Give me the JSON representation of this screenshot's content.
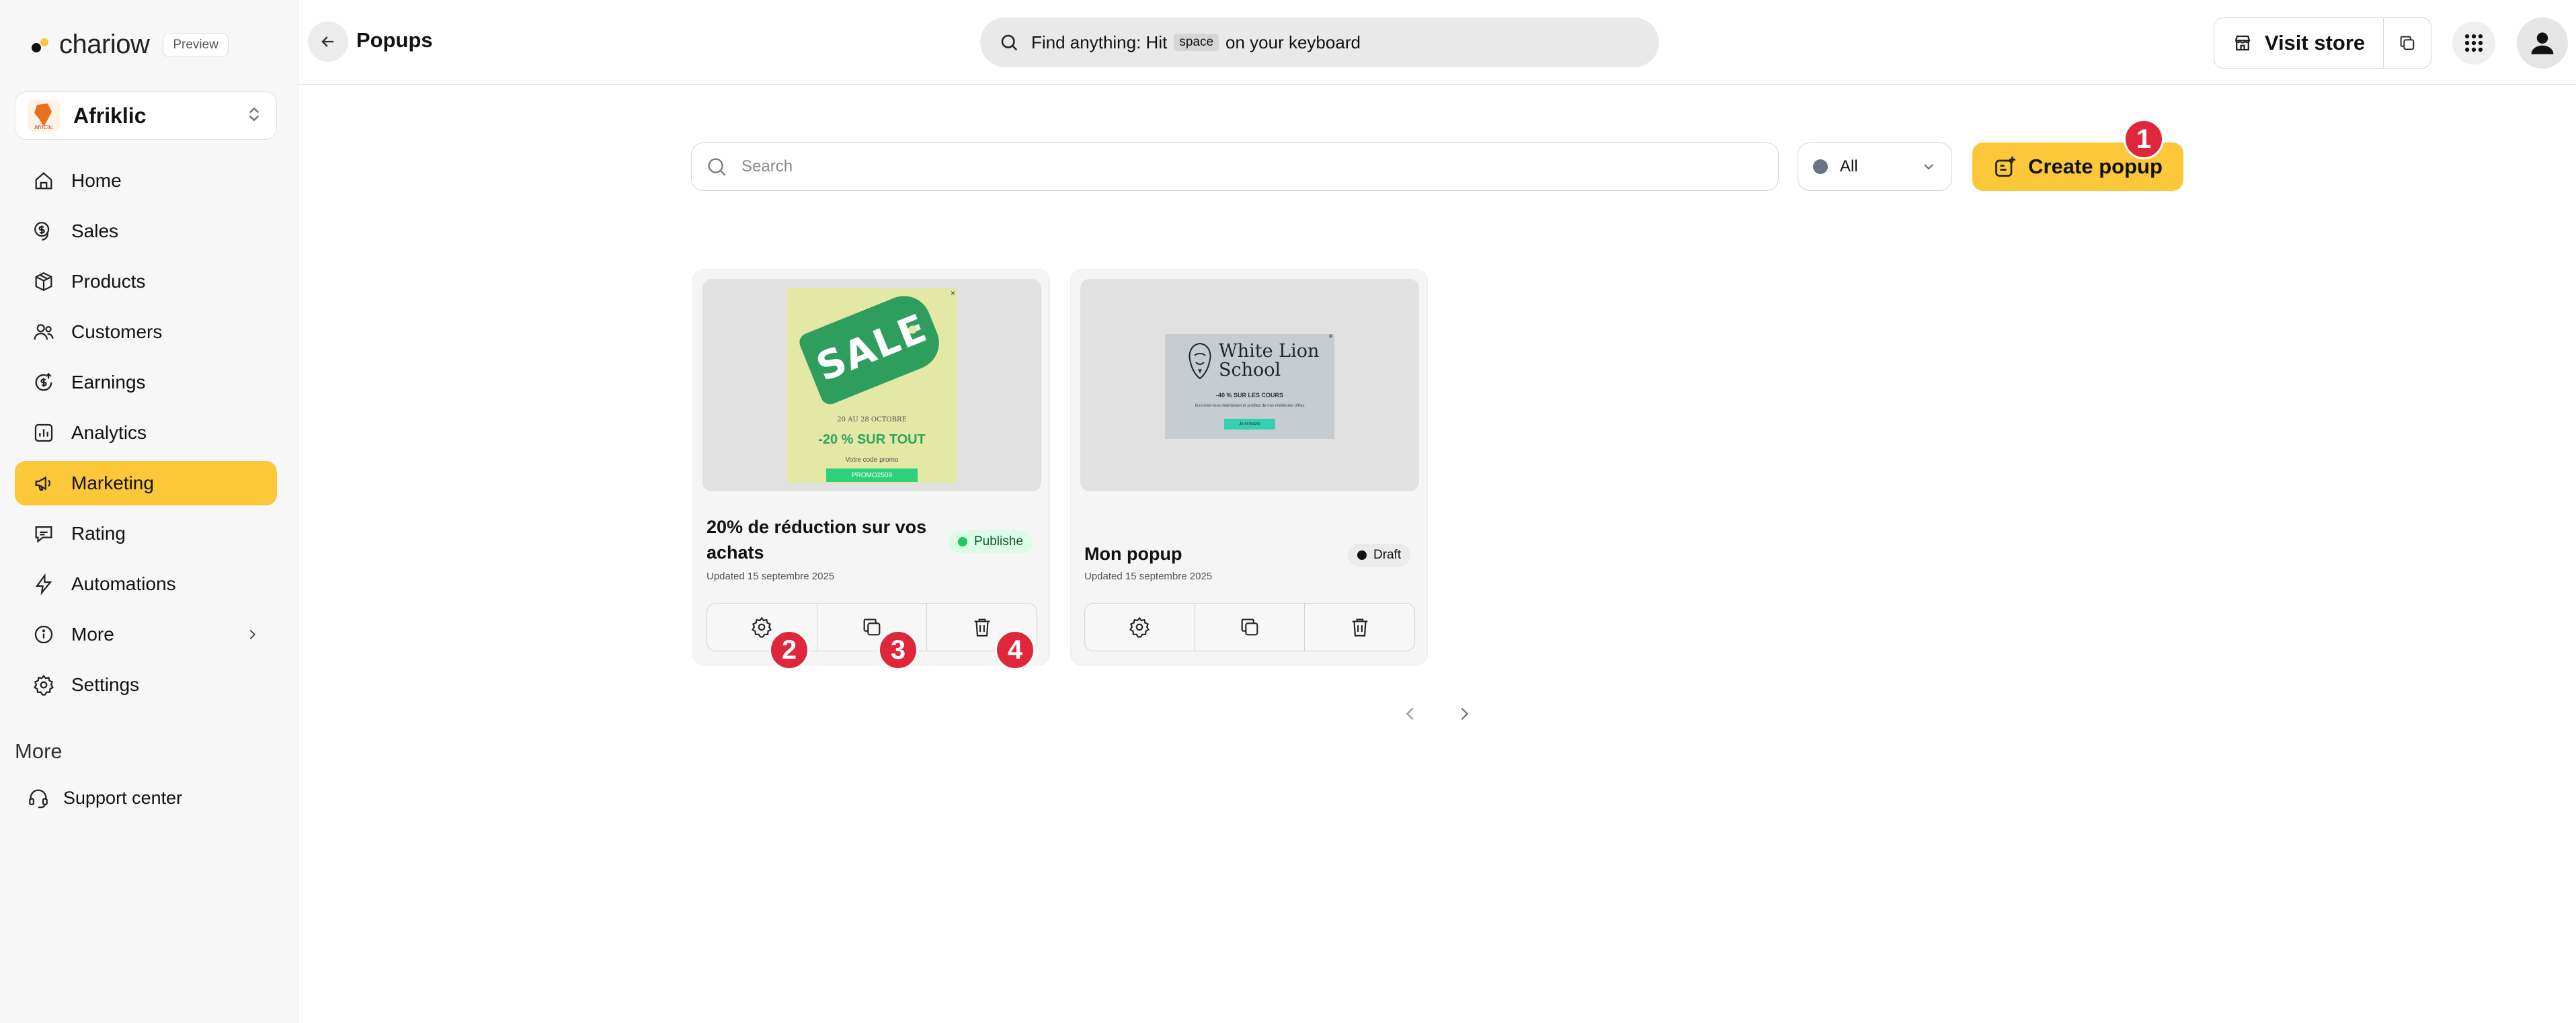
{
  "app": {
    "logo_text": "chariow",
    "preview_label": "Preview",
    "store_name": "Afriklic",
    "store_logo_text": "AfriClic"
  },
  "sidebar": {
    "items": [
      {
        "label": "Home",
        "icon": "home-icon"
      },
      {
        "label": "Sales",
        "icon": "dollar-coin-icon"
      },
      {
        "label": "Products",
        "icon": "box-icon"
      },
      {
        "label": "Customers",
        "icon": "users-icon"
      },
      {
        "label": "Earnings",
        "icon": "earnings-icon"
      },
      {
        "label": "Analytics",
        "icon": "bar-chart-icon"
      },
      {
        "label": "Marketing",
        "icon": "megaphone-icon",
        "active": true
      },
      {
        "label": "Rating",
        "icon": "chat-star-icon"
      },
      {
        "label": "Automations",
        "icon": "lightning-icon"
      },
      {
        "label": "More",
        "icon": "info-icon"
      },
      {
        "label": "Settings",
        "icon": "gear-icon"
      }
    ],
    "more_heading": "More",
    "support_label": "Support center"
  },
  "header": {
    "title": "Popups",
    "search_prefix": "Find anything: Hit",
    "search_key": "space",
    "search_suffix": "on your keyboard",
    "visit_store_label": "Visit store"
  },
  "toolbar": {
    "search_placeholder": "Search",
    "filter_value": "All",
    "create_label": "Create popup"
  },
  "markers": [
    "1",
    "2",
    "3",
    "4"
  ],
  "popups": [
    {
      "title": "20% de réduction sur vos achats",
      "status": "Publishe",
      "updated": "Updated 15 septembre 2025",
      "preview": {
        "tag_text": "SALE",
        "date_text": "20 AU 28 OCTOBRE",
        "discount_text": "-20 % SUR TOUT",
        "code_label": "Votre code promo",
        "code": "PROMO2509",
        "close": "×"
      }
    },
    {
      "title": "Mon popup",
      "status": "Draft",
      "updated": "Updated 15 septembre 2025",
      "preview": {
        "brand_line1": "White Lion",
        "brand_line2": "School",
        "discount_text": "-40 % SUR LES COURS",
        "description": "Inscrivez-vous maintenant et profitez de nos meilleures offres",
        "button_text": "Je m'inscris",
        "close": "×"
      }
    }
  ],
  "colors": {
    "accent": "#fcc83a",
    "marker": "#e0263a",
    "published": "#22c55e",
    "draft": "#111111"
  }
}
